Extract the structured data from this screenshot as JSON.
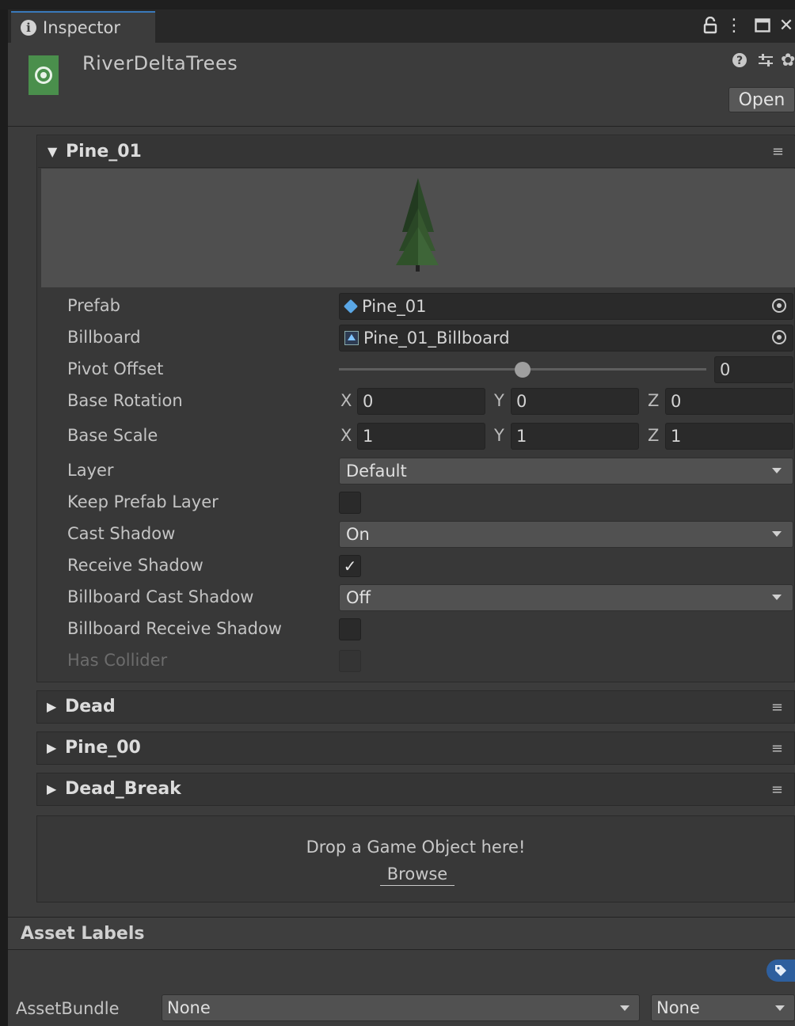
{
  "window": {
    "tab_label": "Inspector",
    "tab_icon": "info-icon",
    "controls": [
      "lock-icon",
      "more-icon",
      "maximize-icon",
      "close-icon"
    ]
  },
  "header": {
    "asset_name": "RiverDeltaTrees",
    "asset_icon": "tree-asset-icon",
    "icons": [
      "help-icon",
      "presets-icon",
      "settings-icon"
    ],
    "open_label": "Open"
  },
  "expanded_section": {
    "title": "Pine_01",
    "fields": {
      "prefab_label": "Prefab",
      "prefab_value": "Pine_01",
      "billboard_label": "Billboard",
      "billboard_value": "Pine_01_Billboard",
      "pivot_label": "Pivot Offset",
      "pivot_value": "0",
      "pivot_slider_fraction": 0.5,
      "rotation_label": "Base Rotation",
      "rotation": {
        "x_label": "X",
        "x": "0",
        "y_label": "Y",
        "y": "0",
        "z_label": "Z",
        "z": "0"
      },
      "scale_label": "Base Scale",
      "scale": {
        "x_label": "X",
        "x": "1",
        "y_label": "Y",
        "y": "1",
        "z_label": "Z",
        "z": "1"
      },
      "layer_label": "Layer",
      "layer_value": "Default",
      "keep_layer_label": "Keep Prefab Layer",
      "keep_layer_checked": false,
      "cast_shadow_label": "Cast Shadow",
      "cast_shadow_value": "On",
      "receive_shadow_label": "Receive Shadow",
      "receive_shadow_checked": true,
      "bb_cast_label": "Billboard Cast Shadow",
      "bb_cast_value": "Off",
      "bb_receive_label": "Billboard Receive Shadow",
      "bb_receive_checked": false,
      "collider_label": "Has Collider",
      "collider_checked": false
    }
  },
  "collapsed_sections": [
    {
      "title": "Dead"
    },
    {
      "title": "Pine_00"
    },
    {
      "title": "Dead_Break"
    }
  ],
  "drop_area": {
    "message": "Drop a Game Object here!",
    "browse_label": "Browse"
  },
  "asset_labels": {
    "title": "Asset Labels",
    "bundle_label": "AssetBundle",
    "bundle_value": "None",
    "variant_value": "None"
  },
  "colors": {
    "accent": "#3a79bb",
    "panel": "#3c3c3c",
    "field": "#2a2a2a"
  }
}
